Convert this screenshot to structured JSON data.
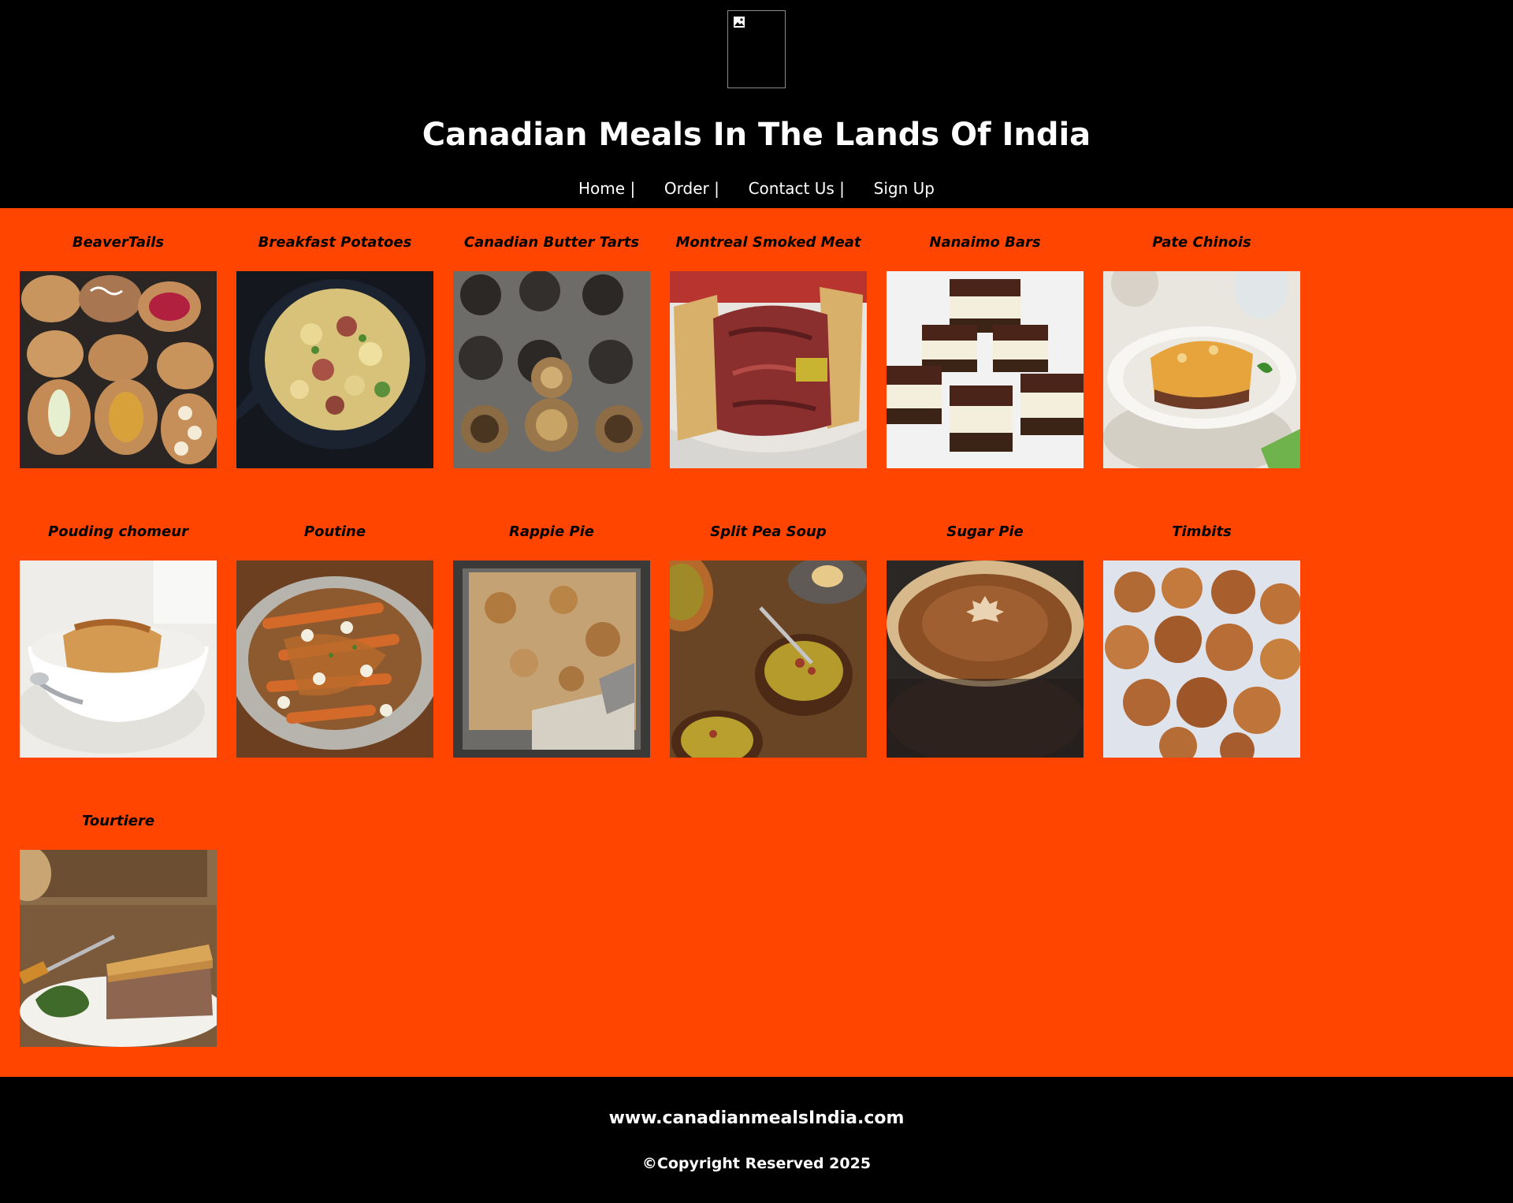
{
  "header": {
    "title": "Canadian Meals In The Lands Of India",
    "nav": [
      {
        "label": "Home",
        "separator": "|"
      },
      {
        "label": "Order",
        "separator": "|"
      },
      {
        "label": "Contact Us",
        "separator": "|"
      },
      {
        "label": "Sign Up",
        "separator": ""
      }
    ]
  },
  "meals": [
    {
      "name": "BeaverTails"
    },
    {
      "name": "Breakfast Potatoes"
    },
    {
      "name": "Canadian Butter Tarts"
    },
    {
      "name": "Montreal Smoked Meat"
    },
    {
      "name": "Nanaimo Bars"
    },
    {
      "name": "Pate Chinois"
    },
    {
      "name": "Pouding chomeur"
    },
    {
      "name": "Poutine"
    },
    {
      "name": "Rappie Pie"
    },
    {
      "name": "Split Pea Soup"
    },
    {
      "name": "Sugar Pie"
    },
    {
      "name": "Timbits"
    },
    {
      "name": "Tourtiere"
    }
  ],
  "footer": {
    "url": "www.canadianmealsIndia.com",
    "copyright": "©Copyright Reserved 2025"
  },
  "colors": {
    "header_bg": "#000000",
    "gallery_bg": "#ff4500",
    "footer_bg": "#000000",
    "text_light": "#ffffff",
    "text_dark": "#000000"
  }
}
